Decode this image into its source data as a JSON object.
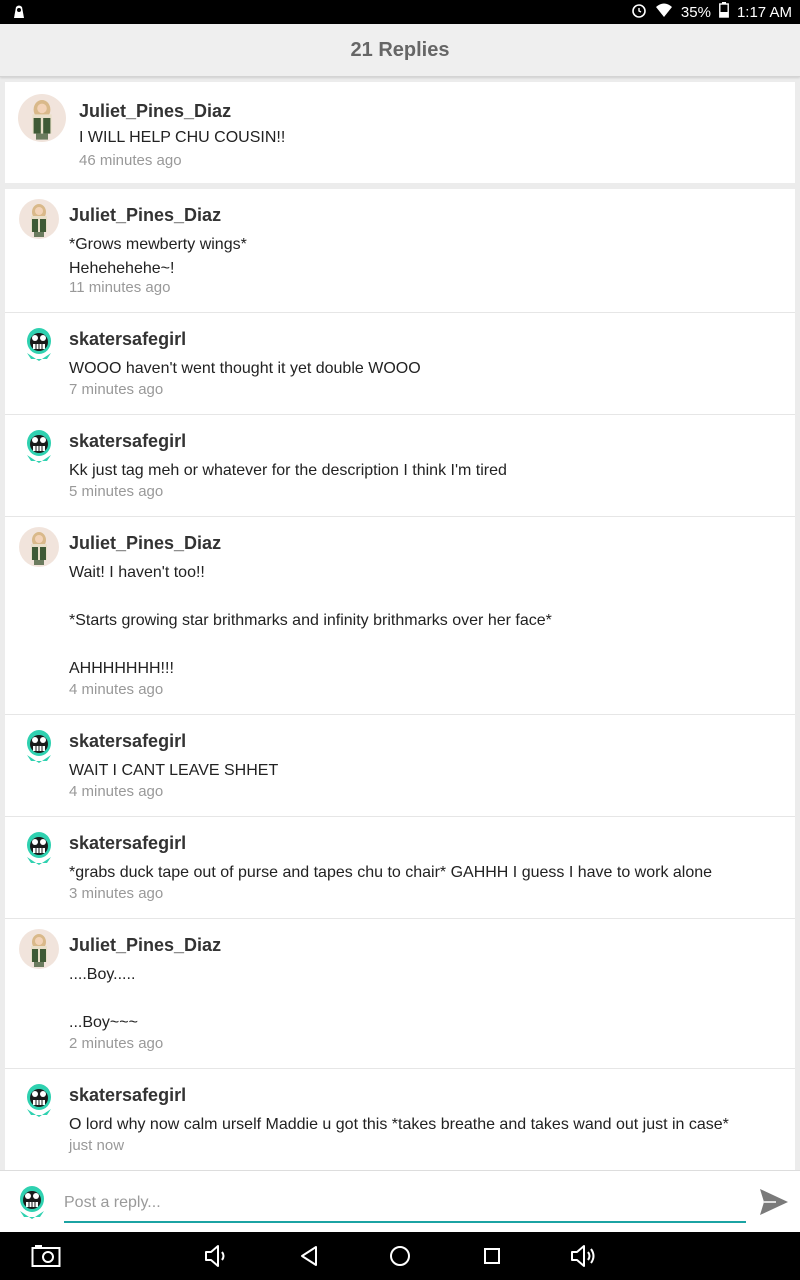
{
  "status_bar": {
    "battery": "35%",
    "time": "1:17 AM",
    "icons": [
      "notification-icon",
      "alarm-icon",
      "wifi-icon",
      "battery-icon"
    ]
  },
  "header": {
    "title": "21 Replies"
  },
  "original_post": {
    "author": "Juliet_Pines_Diaz",
    "text": "I WILL HELP CHU COUSIN!!",
    "time": "46 minutes ago",
    "avatar": "juliet-avatar"
  },
  "replies": [
    {
      "author": "Juliet_Pines_Diaz",
      "text": "*Grows mewberty wings*\nHehehehehe~!",
      "time": "11 minutes ago",
      "avatar": "juliet-avatar"
    },
    {
      "author": "skatersafegirl",
      "text": "WOOO haven't went thought it yet double WOOO",
      "time": "7 minutes ago",
      "avatar": "skater-avatar"
    },
    {
      "author": "skatersafegirl",
      "text": "Kk just tag meh or whatever for the description I think I'm tired",
      "time": "5 minutes ago",
      "avatar": "skater-avatar"
    },
    {
      "author": "Juliet_Pines_Diaz",
      "text": "Wait! I haven't too!!\n\n*Starts growing star brithmarks and infinity brithmarks over her face*\n\nAHHHHHHH!!!",
      "time": "4 minutes ago",
      "avatar": "juliet-avatar"
    },
    {
      "author": "skatersafegirl",
      "text": "WAIT I CANT LEAVE SHHET",
      "time": "4 minutes ago",
      "avatar": "skater-avatar"
    },
    {
      "author": "skatersafegirl",
      "text": "*grabs duck tape out of purse and tapes chu to chair* GAHHH I guess I have to work alone",
      "time": "3 minutes ago",
      "avatar": "skater-avatar"
    },
    {
      "author": "Juliet_Pines_Diaz",
      "text": "....Boy.....\n\n...Boy~~~",
      "time": "2 minutes ago",
      "avatar": "juliet-avatar"
    },
    {
      "author": "skatersafegirl",
      "text": "O lord  why now calm urself Maddie u got this *takes breathe and takes wand out just in case*",
      "time": "just now",
      "avatar": "skater-avatar"
    }
  ],
  "composer": {
    "placeholder": "Post a reply...",
    "value": "",
    "send_icon": "send-icon",
    "avatar": "skater-avatar"
  },
  "nav_bar": {
    "icons": [
      "camera-icon",
      "volume-down-icon",
      "back-icon",
      "home-icon",
      "recents-icon",
      "volume-up-icon"
    ]
  },
  "colors": {
    "accent": "#1ba3a3",
    "timestamp": "#999999",
    "header_text": "#666666"
  }
}
